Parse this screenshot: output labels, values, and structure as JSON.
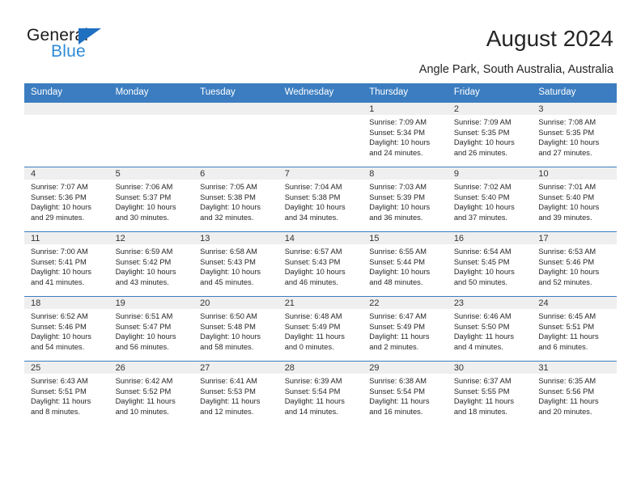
{
  "brand": {
    "name_part1": "General",
    "name_part2": "Blue",
    "triangle_color": "#1f70c1",
    "blue_text_color": "#2e8bd8"
  },
  "header": {
    "title": "August 2024",
    "location": "Angle Park, South Australia, Australia"
  },
  "theme": {
    "header_bg": "#3b7dc0",
    "daynum_band_bg": "#efefef",
    "cell_bg": "#ffffff",
    "text_color": "#262626"
  },
  "calendar": {
    "weekday_headers": [
      "Sunday",
      "Monday",
      "Tuesday",
      "Wednesday",
      "Thursday",
      "Friday",
      "Saturday"
    ],
    "weeks": [
      [
        {
          "empty": true
        },
        {
          "empty": true
        },
        {
          "empty": true
        },
        {
          "empty": true
        },
        {
          "day": "1",
          "sunrise": "Sunrise: 7:09 AM",
          "sunset": "Sunset: 5:34 PM",
          "daylight1": "Daylight: 10 hours",
          "daylight2": "and 24 minutes."
        },
        {
          "day": "2",
          "sunrise": "Sunrise: 7:09 AM",
          "sunset": "Sunset: 5:35 PM",
          "daylight1": "Daylight: 10 hours",
          "daylight2": "and 26 minutes."
        },
        {
          "day": "3",
          "sunrise": "Sunrise: 7:08 AM",
          "sunset": "Sunset: 5:35 PM",
          "daylight1": "Daylight: 10 hours",
          "daylight2": "and 27 minutes."
        }
      ],
      [
        {
          "day": "4",
          "sunrise": "Sunrise: 7:07 AM",
          "sunset": "Sunset: 5:36 PM",
          "daylight1": "Daylight: 10 hours",
          "daylight2": "and 29 minutes."
        },
        {
          "day": "5",
          "sunrise": "Sunrise: 7:06 AM",
          "sunset": "Sunset: 5:37 PM",
          "daylight1": "Daylight: 10 hours",
          "daylight2": "and 30 minutes."
        },
        {
          "day": "6",
          "sunrise": "Sunrise: 7:05 AM",
          "sunset": "Sunset: 5:38 PM",
          "daylight1": "Daylight: 10 hours",
          "daylight2": "and 32 minutes."
        },
        {
          "day": "7",
          "sunrise": "Sunrise: 7:04 AM",
          "sunset": "Sunset: 5:38 PM",
          "daylight1": "Daylight: 10 hours",
          "daylight2": "and 34 minutes."
        },
        {
          "day": "8",
          "sunrise": "Sunrise: 7:03 AM",
          "sunset": "Sunset: 5:39 PM",
          "daylight1": "Daylight: 10 hours",
          "daylight2": "and 36 minutes."
        },
        {
          "day": "9",
          "sunrise": "Sunrise: 7:02 AM",
          "sunset": "Sunset: 5:40 PM",
          "daylight1": "Daylight: 10 hours",
          "daylight2": "and 37 minutes."
        },
        {
          "day": "10",
          "sunrise": "Sunrise: 7:01 AM",
          "sunset": "Sunset: 5:40 PM",
          "daylight1": "Daylight: 10 hours",
          "daylight2": "and 39 minutes."
        }
      ],
      [
        {
          "day": "11",
          "sunrise": "Sunrise: 7:00 AM",
          "sunset": "Sunset: 5:41 PM",
          "daylight1": "Daylight: 10 hours",
          "daylight2": "and 41 minutes."
        },
        {
          "day": "12",
          "sunrise": "Sunrise: 6:59 AM",
          "sunset": "Sunset: 5:42 PM",
          "daylight1": "Daylight: 10 hours",
          "daylight2": "and 43 minutes."
        },
        {
          "day": "13",
          "sunrise": "Sunrise: 6:58 AM",
          "sunset": "Sunset: 5:43 PM",
          "daylight1": "Daylight: 10 hours",
          "daylight2": "and 45 minutes."
        },
        {
          "day": "14",
          "sunrise": "Sunrise: 6:57 AM",
          "sunset": "Sunset: 5:43 PM",
          "daylight1": "Daylight: 10 hours",
          "daylight2": "and 46 minutes."
        },
        {
          "day": "15",
          "sunrise": "Sunrise: 6:55 AM",
          "sunset": "Sunset: 5:44 PM",
          "daylight1": "Daylight: 10 hours",
          "daylight2": "and 48 minutes."
        },
        {
          "day": "16",
          "sunrise": "Sunrise: 6:54 AM",
          "sunset": "Sunset: 5:45 PM",
          "daylight1": "Daylight: 10 hours",
          "daylight2": "and 50 minutes."
        },
        {
          "day": "17",
          "sunrise": "Sunrise: 6:53 AM",
          "sunset": "Sunset: 5:46 PM",
          "daylight1": "Daylight: 10 hours",
          "daylight2": "and 52 minutes."
        }
      ],
      [
        {
          "day": "18",
          "sunrise": "Sunrise: 6:52 AM",
          "sunset": "Sunset: 5:46 PM",
          "daylight1": "Daylight: 10 hours",
          "daylight2": "and 54 minutes."
        },
        {
          "day": "19",
          "sunrise": "Sunrise: 6:51 AM",
          "sunset": "Sunset: 5:47 PM",
          "daylight1": "Daylight: 10 hours",
          "daylight2": "and 56 minutes."
        },
        {
          "day": "20",
          "sunrise": "Sunrise: 6:50 AM",
          "sunset": "Sunset: 5:48 PM",
          "daylight1": "Daylight: 10 hours",
          "daylight2": "and 58 minutes."
        },
        {
          "day": "21",
          "sunrise": "Sunrise: 6:48 AM",
          "sunset": "Sunset: 5:49 PM",
          "daylight1": "Daylight: 11 hours",
          "daylight2": "and 0 minutes."
        },
        {
          "day": "22",
          "sunrise": "Sunrise: 6:47 AM",
          "sunset": "Sunset: 5:49 PM",
          "daylight1": "Daylight: 11 hours",
          "daylight2": "and 2 minutes."
        },
        {
          "day": "23",
          "sunrise": "Sunrise: 6:46 AM",
          "sunset": "Sunset: 5:50 PM",
          "daylight1": "Daylight: 11 hours",
          "daylight2": "and 4 minutes."
        },
        {
          "day": "24",
          "sunrise": "Sunrise: 6:45 AM",
          "sunset": "Sunset: 5:51 PM",
          "daylight1": "Daylight: 11 hours",
          "daylight2": "and 6 minutes."
        }
      ],
      [
        {
          "day": "25",
          "sunrise": "Sunrise: 6:43 AM",
          "sunset": "Sunset: 5:51 PM",
          "daylight1": "Daylight: 11 hours",
          "daylight2": "and 8 minutes."
        },
        {
          "day": "26",
          "sunrise": "Sunrise: 6:42 AM",
          "sunset": "Sunset: 5:52 PM",
          "daylight1": "Daylight: 11 hours",
          "daylight2": "and 10 minutes."
        },
        {
          "day": "27",
          "sunrise": "Sunrise: 6:41 AM",
          "sunset": "Sunset: 5:53 PM",
          "daylight1": "Daylight: 11 hours",
          "daylight2": "and 12 minutes."
        },
        {
          "day": "28",
          "sunrise": "Sunrise: 6:39 AM",
          "sunset": "Sunset: 5:54 PM",
          "daylight1": "Daylight: 11 hours",
          "daylight2": "and 14 minutes."
        },
        {
          "day": "29",
          "sunrise": "Sunrise: 6:38 AM",
          "sunset": "Sunset: 5:54 PM",
          "daylight1": "Daylight: 11 hours",
          "daylight2": "and 16 minutes."
        },
        {
          "day": "30",
          "sunrise": "Sunrise: 6:37 AM",
          "sunset": "Sunset: 5:55 PM",
          "daylight1": "Daylight: 11 hours",
          "daylight2": "and 18 minutes."
        },
        {
          "day": "31",
          "sunrise": "Sunrise: 6:35 AM",
          "sunset": "Sunset: 5:56 PM",
          "daylight1": "Daylight: 11 hours",
          "daylight2": "and 20 minutes."
        }
      ]
    ]
  }
}
